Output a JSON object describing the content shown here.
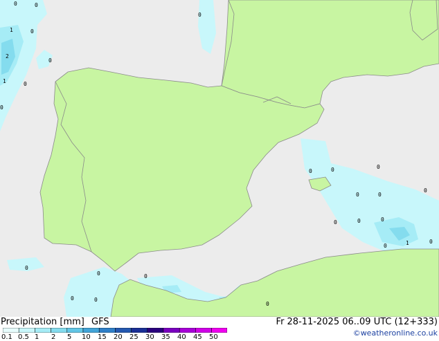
{
  "header": {
    "title": "Precipitation [mm]",
    "model": "GFS",
    "valid_time": "Fr 28-11-2025 06..09 UTC (12+333)",
    "credit": "©weatheronline.co.uk"
  },
  "legend": {
    "ticks": [
      "0.1",
      "0.5",
      "1",
      "2",
      "5",
      "10",
      "15",
      "20",
      "25",
      "30",
      "35",
      "40",
      "45",
      "50"
    ],
    "colors": [
      "#e7fdfd",
      "#c8f7fb",
      "#a6ecf6",
      "#84dcee",
      "#62c6e6",
      "#42a4d8",
      "#2f7fc8",
      "#2458b0",
      "#1a2f96",
      "#2a007e",
      "#7a00c0",
      "#a800d8",
      "#d000e8",
      "#f000f0"
    ]
  },
  "map": {
    "colors": {
      "sea": "#ececec",
      "land": "#c8f5a2",
      "border": "#8a8a8a"
    },
    "labels": [
      "0",
      "1",
      "0",
      "2",
      "0",
      "1",
      "0",
      "0",
      "0",
      "0",
      "0",
      "0",
      "0",
      "0",
      "0",
      "0",
      "0",
      "0",
      "0",
      "1",
      "0",
      "0",
      "0",
      "0",
      "0",
      "0",
      "0",
      "0"
    ]
  }
}
